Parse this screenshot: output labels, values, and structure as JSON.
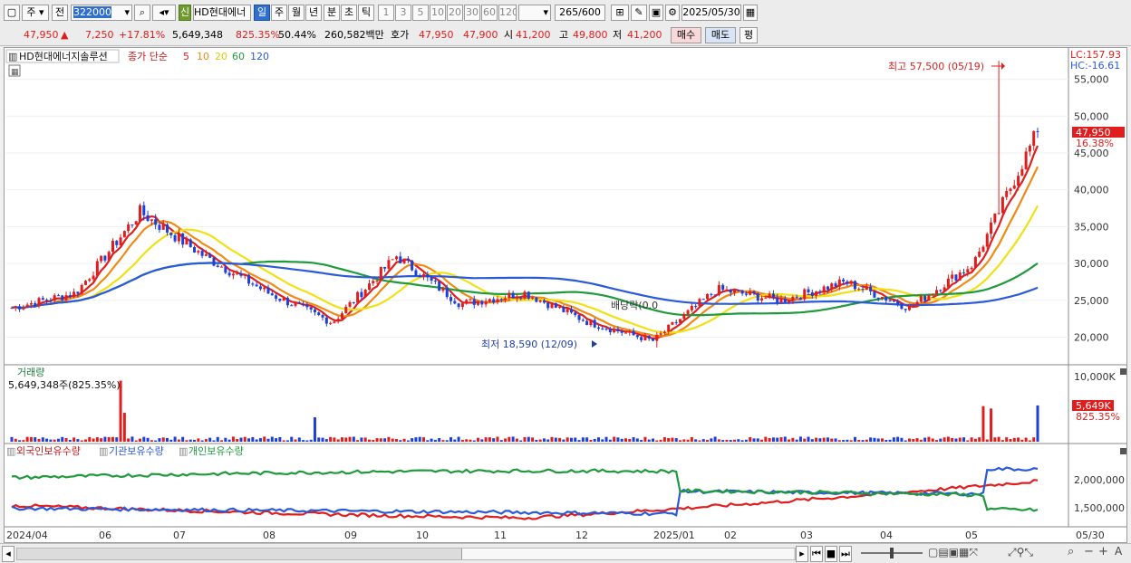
{
  "toolbar": {
    "type_select": "주",
    "prev_label": "전",
    "code_value": "322000",
    "new_badge": "신",
    "stock_name": "HD현대에너",
    "periods": [
      "일",
      "주",
      "월",
      "년",
      "분",
      "초",
      "틱"
    ],
    "intervals": [
      "1",
      "3",
      "5",
      "10",
      "20",
      "30",
      "60",
      "120"
    ],
    "count_value": "265",
    "count_total": "/600",
    "date_value": "2025/05/30"
  },
  "info": {
    "price": "47,950",
    "change_arrow": "▲",
    "change": "7,250",
    "change_pct": "+17.81%",
    "volume": "5,649,348",
    "volume_ratio": "825.35%",
    "turnover": "50.44%",
    "amount": "260,582백만",
    "quote_label": "호가",
    "ask": "47,950",
    "bid": "47,900",
    "open_label": "시",
    "open": "41,200",
    "high_label": "고",
    "high": "49,800",
    "low_label": "저",
    "low": "41,200",
    "buy_label": "매수",
    "sell_label": "매도",
    "eval_label": "평"
  },
  "chart": {
    "legend_name": "HD현대에너지솔루션",
    "legend_ma_label": "종가 단순",
    "ma_periods": [
      "5",
      "10",
      "20",
      "60",
      "120"
    ],
    "ma_colors": [
      "#e0201e",
      "#f08a14",
      "#f0e014",
      "#1e9a3c",
      "#2a5ad8"
    ],
    "lc": "LC:157.93",
    "hc": "HC:-16.61",
    "current_price_tag": "47,950",
    "current_pct_tag": "16.38%",
    "max_annotation": "최고 57,500 (05/19)",
    "min_annotation": "최저 18,590 (12/09)",
    "dividend_annotation": "배당락(0.0",
    "price_ticks": [
      "55,000",
      "50,000",
      "45,000",
      "40,000",
      "35,000",
      "30,000",
      "25,000",
      "20,000"
    ],
    "volume_title": "거래량",
    "volume_info": "5,649,348주(825.35%)",
    "volume_tick": "10,000K",
    "volume_tag": "5,649K",
    "volume_pct_tag": "825.35%",
    "holders_legend": [
      "외국인보유수량",
      "기관보유수량",
      "개인보유수량"
    ],
    "holders_ticks": [
      "2,000,000",
      "1,500,000"
    ],
    "x_labels": [
      "2024/04",
      "06",
      "07",
      "08",
      "09",
      "10",
      "11",
      "12",
      "2025/01",
      "02",
      "03",
      "04",
      "05",
      "05/30"
    ]
  },
  "chart_data": {
    "type": "candlestick",
    "price_range": [
      16500,
      59000
    ],
    "price_points": [
      {
        "month": "2024/04",
        "close": 24000
      },
      {
        "month": "2024/05",
        "close": 26000
      },
      {
        "month": "2024/05",
        "close": 37000
      },
      {
        "month": "2024/06",
        "close": 31000
      },
      {
        "month": "2024/07",
        "close": 26000
      },
      {
        "month": "2024/08",
        "close": 22000
      },
      {
        "month": "2024/08",
        "close": 31000
      },
      {
        "month": "2024/09",
        "close": 24500
      },
      {
        "month": "2024/10",
        "close": 26000
      },
      {
        "month": "2024/11",
        "close": 22000
      },
      {
        "month": "2024/12",
        "close": 19500
      },
      {
        "month": "2025/01",
        "close": 26500
      },
      {
        "month": "2025/02",
        "close": 25000
      },
      {
        "month": "2025/03",
        "close": 27500
      },
      {
        "month": "2025/04",
        "close": 24000
      },
      {
        "month": "2025/05",
        "close": 30000
      },
      {
        "month": "2025/05",
        "close": 47950
      }
    ],
    "max": {
      "label": "05/19",
      "value": 57500
    },
    "min": {
      "label": "12/09",
      "value": 18590
    },
    "volume_max": 10000,
    "holders_range": [
      1250000,
      2500000
    ]
  }
}
